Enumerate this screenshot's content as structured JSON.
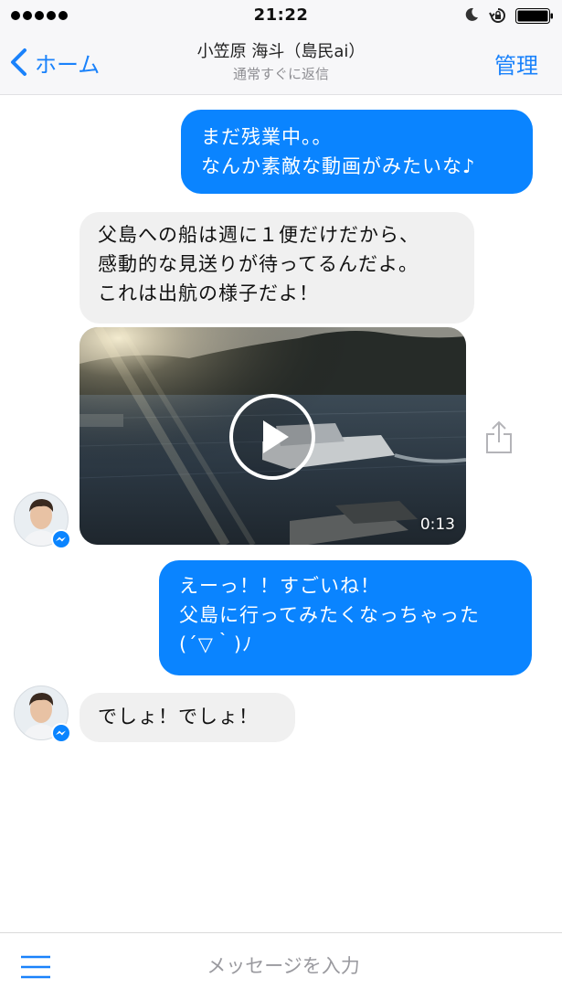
{
  "status_bar": {
    "time": "21:22",
    "icons": [
      "signal-dots-icon",
      "moon-icon",
      "rotation-lock-icon",
      "battery-icon"
    ]
  },
  "nav": {
    "back_label": "ホーム",
    "contact_name": "小笠原 海斗（島民ai）",
    "contact_status": "通常すぐに返信",
    "manage_label": "管理"
  },
  "messages": [
    {
      "direction": "outgoing",
      "text": "まだ残業中。。\nなんか素敵な動画がみたいな♪"
    },
    {
      "direction": "incoming",
      "text": "父島への船は週に１便だけだから、\n感動的な見送りが待ってるんだよ。\nこれは出航の様子だよ！"
    },
    {
      "direction": "incoming",
      "type": "video",
      "duration": "0:13"
    },
    {
      "direction": "outgoing",
      "text": "えーっ！！すごいね！\n父島に行ってみたくなっちゃった\n(´▽｀)ﾉ"
    },
    {
      "direction": "incoming",
      "text": "でしょ！でしょ！"
    }
  ],
  "input": {
    "placeholder": "メッセージを入力"
  },
  "colors": {
    "accent": "#1a82fb",
    "outgoing_bubble": "#0a84ff",
    "incoming_bubble": "#f0f0f0"
  }
}
